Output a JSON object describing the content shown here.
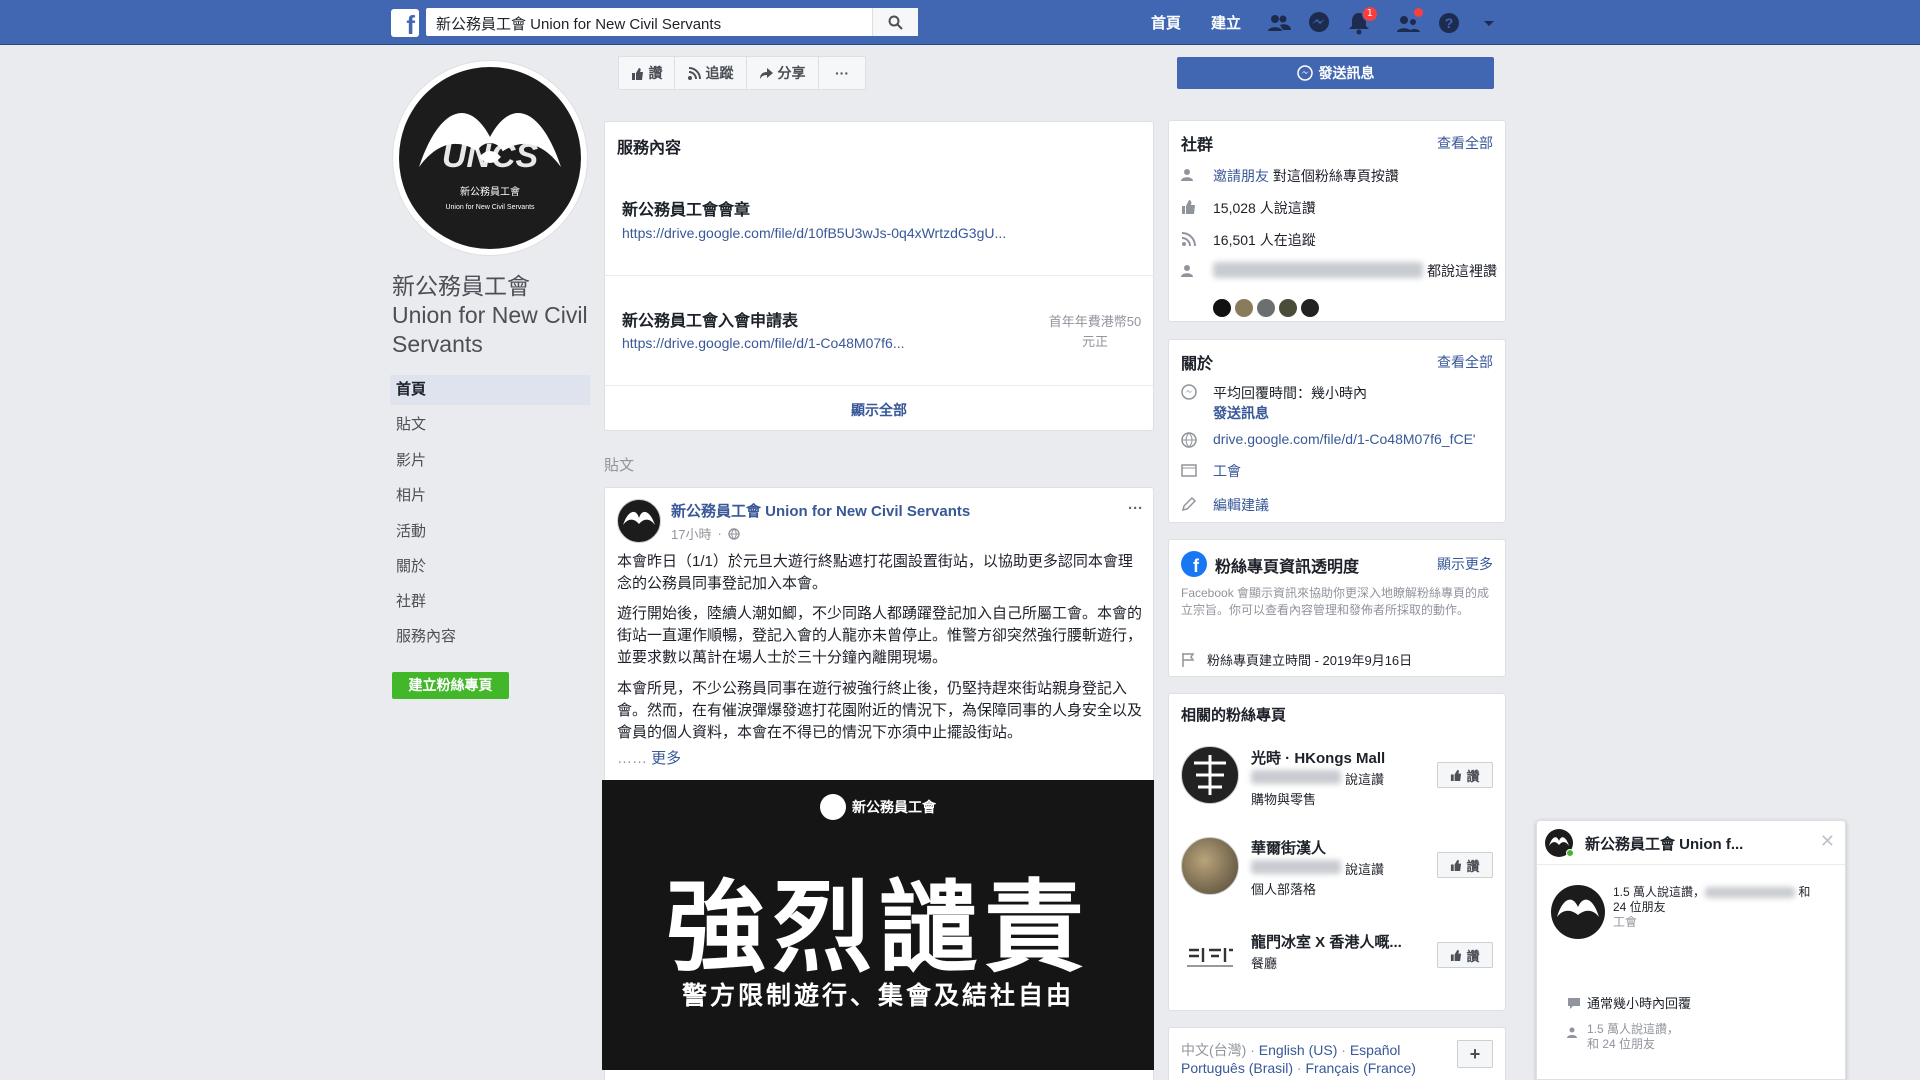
{
  "topbar": {
    "search_value": "新公務員工會 Union for New Civil Servants",
    "nav_home": "首頁",
    "nav_create": "建立",
    "notif_count": "1"
  },
  "page": {
    "name": "新公務員工會 Union for New Civil Servants",
    "logo_text": "UNCS",
    "logo_caption_cn": "新公務員工會",
    "logo_caption_en": "Union for New Civil Servants"
  },
  "left_nav": [
    {
      "label": "首頁"
    },
    {
      "label": "貼文"
    },
    {
      "label": "影片"
    },
    {
      "label": "相片"
    },
    {
      "label": "活動"
    },
    {
      "label": "關於"
    },
    {
      "label": "社群"
    },
    {
      "label": "服務內容"
    }
  ],
  "create_page_button": "建立粉絲專頁",
  "actions": {
    "like": "讚",
    "follow": "追蹤",
    "share": "分享",
    "more": "···"
  },
  "services": {
    "title": "服務內容",
    "items": [
      {
        "title": "新公務員工會會章",
        "url": "https://drive.google.com/file/d/10fB5U3wJs-0q4xWrtzdG3gU...",
        "price": ""
      },
      {
        "title": "新公務員工會入會申請表",
        "url": "https://drive.google.com/file/d/1-Co48M07f6...",
        "price": "首年年費港幣50元正"
      }
    ],
    "show_all": "顯示全部"
  },
  "posts_label": "貼文",
  "post": {
    "author": "新公務員工會 Union for New Civil Servants",
    "time": "17小時",
    "paragraphs": [
      "本會昨日（1/1）於元旦大遊行終點遮打花園設置街站，以協助更多認同本會理念的公務員同事登記加入本會。",
      "遊行開始後，陸續人潮如鯽，不少同路人都踴躍登記加入自己所屬工會。本會的街站一直運作順暢，登記入會的人龍亦未曾停止。惟警方卻突然強行腰斬遊行，並要求數以萬計在場人士於三十分鐘內離開現場。",
      "本會所見，不少公務員同事在遊行被強行終止後，仍堅持趕來街站親身登記入會。然而，在有催淚彈爆發遮打花園附近的情況下，為保障同事的人身安全以及會員的個人資料，本會在不得已的情況下亦須中止擺設街站。"
    ],
    "more": "更多",
    "banner_org": "新公務員工會",
    "banner_title": "強烈譴責",
    "banner_subtitle": "警方限制遊行、集會及結社自由"
  },
  "send_message_button": "發送訊息",
  "community": {
    "title": "社群",
    "see_all": "查看全部",
    "invite_link": "邀請朋友",
    "invite_text": "對這個粉絲專頁按讚",
    "likes": "15,028 人說這讚",
    "follows": "16,501 人在追蹤",
    "friends_text": "都說這裡讚"
  },
  "about": {
    "title": "關於",
    "see_all": "查看全部",
    "response": "平均回覆時間：幾小時內",
    "send_message": "發送訊息",
    "website": "drive.google.com/file/d/1-Co48M07f6_fCE'",
    "category": "工會",
    "suggest_edit": "編輯建議"
  },
  "transparency": {
    "title": "粉絲專頁資訊透明度",
    "show_more": "顯示更多",
    "desc": "Facebook 會顯示資訊來協助你更深入地瞭解粉絲專頁的成立宗旨。你可以查看內容管理和發佈者所採取的動作。",
    "created": "粉絲專頁建立時間 - 2019年9月16日"
  },
  "related": {
    "title": "相關的粉絲專頁",
    "items": [
      {
        "name": "光時 · HKongs Mall",
        "likes": "說這讚",
        "category": "購物與零售",
        "like_label": "讚"
      },
      {
        "name": "華爾街漢人",
        "likes": "說這讚",
        "category": "個人部落格",
        "like_label": "讚"
      },
      {
        "name": "龍門冰室 X 香港人嘅...",
        "likes": "",
        "category": "餐廳",
        "like_label": "讚"
      }
    ]
  },
  "languages": {
    "line1": [
      "中文(台灣)",
      "English (US)",
      "Español"
    ],
    "line2": [
      "Português (Brasil)",
      "Français (France)"
    ],
    "add": "+"
  },
  "chat": {
    "title": "新公務員工會 Union f...",
    "likes_line": "1.5 萬人說這讚，",
    "likes_suffix": "和",
    "friends_line": "24 位朋友",
    "category": "工會",
    "response": "通常幾小時內回覆",
    "footer_likes": "1.5 萬人說這讚，",
    "footer_friends": "和 24 位朋友"
  },
  "colors": {
    "brand": "#4267b2",
    "link": "#385898",
    "green": "#42b72a",
    "bg": "#e9ebee"
  }
}
